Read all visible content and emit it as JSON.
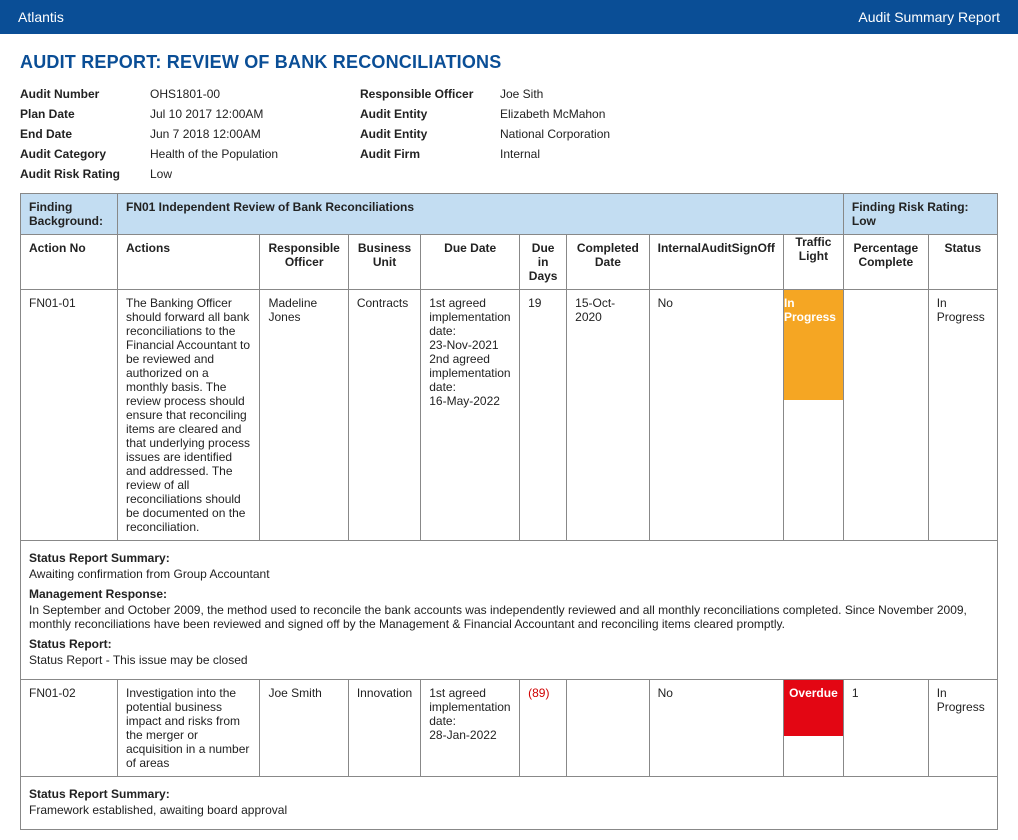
{
  "header": {
    "app_name": "Atlantis",
    "page_title": "Audit Summary Report"
  },
  "report": {
    "title": "AUDIT REPORT: REVIEW OF BANK RECONCILIATIONS",
    "left_meta": [
      {
        "label": "Audit Number",
        "value": "OHS1801-00"
      },
      {
        "label": "Plan Date",
        "value": "Jul 10 2017 12:00AM"
      },
      {
        "label": "End Date",
        "value": "Jun 7 2018 12:00AM"
      },
      {
        "label": "Audit Category",
        "value": "Health of the Population"
      },
      {
        "label": "Audit Risk Rating",
        "value": "Low"
      }
    ],
    "right_meta": [
      {
        "label": "Responsible Officer",
        "value": "Joe Sith"
      },
      {
        "label": "Audit Entity",
        "value": "Elizabeth McMahon"
      },
      {
        "label": "Audit Entity",
        "value": "National Corporation"
      },
      {
        "label": "Audit Firm",
        "value": "Internal"
      }
    ]
  },
  "finding": {
    "bg_label": "Finding Background:",
    "bg_text": "FN01 Independent Review of Bank Reconciliations",
    "risk_label": "Finding Risk Rating: Low"
  },
  "columns": {
    "action_no": "Action No",
    "actions": "Actions",
    "officer": "Responsible Officer",
    "bu": "Business Unit",
    "due_date": "Due Date",
    "due_days": "Due in Days",
    "completed": "Completed Date",
    "signoff": "InternalAuditSignOff",
    "traffic": "Traffic Light",
    "percent": "Percentage Complete",
    "status": "Status"
  },
  "rows": [
    {
      "action_no": "FN01-01",
      "actions": "The Banking Officer should forward all bank reconciliations to the Financial Accountant to be reviewed and authorized on a monthly basis. The review process should ensure that reconciling items are cleared and that underlying process issues are identified and addressed. The review of all reconciliations should be documented on the reconciliation.",
      "officer": "Madeline Jones",
      "bu": "Contracts",
      "due_date": "1st agreed implementation date:\n23-Nov-2021\n2nd agreed implementation date:\n16-May-2022",
      "due_days": "19",
      "due_days_neg": false,
      "completed": "15-Oct-2020",
      "signoff": "No",
      "traffic": "In Progress",
      "traffic_class": "in-progress",
      "percent": "",
      "status": "In Progress"
    },
    {
      "action_no": "FN01-02",
      "actions": "Investigation into the potential business impact and risks from the merger or acquisition in a number of areas",
      "officer": "Joe Smith",
      "bu": "Innovation",
      "due_date": "1st agreed implementation date:\n28-Jan-2022",
      "due_days": "(89)",
      "due_days_neg": true,
      "completed": "",
      "signoff": "No",
      "traffic": "Overdue",
      "traffic_class": "overdue",
      "percent": "1",
      "status": "In Progress"
    }
  ],
  "notes1": {
    "srs_label": "Status Report Summary:",
    "srs_text": "Awaiting confirmation from Group Accountant",
    "mr_label": "Management Response:",
    "mr_text": "In September and October 2009, the method used to reconcile the bank accounts was independently reviewed and all monthly reconciliations completed. Since November 2009, monthly reconciliations have been reviewed and signed off by the Management & Financial Accountant and reconciling items cleared promptly.",
    "sr_label": "Status Report:",
    "sr_text": "Status Report - This issue may be closed"
  },
  "notes2": {
    "srs_label": "Status Report Summary:",
    "srs_text": "Framework established, awaiting board approval"
  }
}
